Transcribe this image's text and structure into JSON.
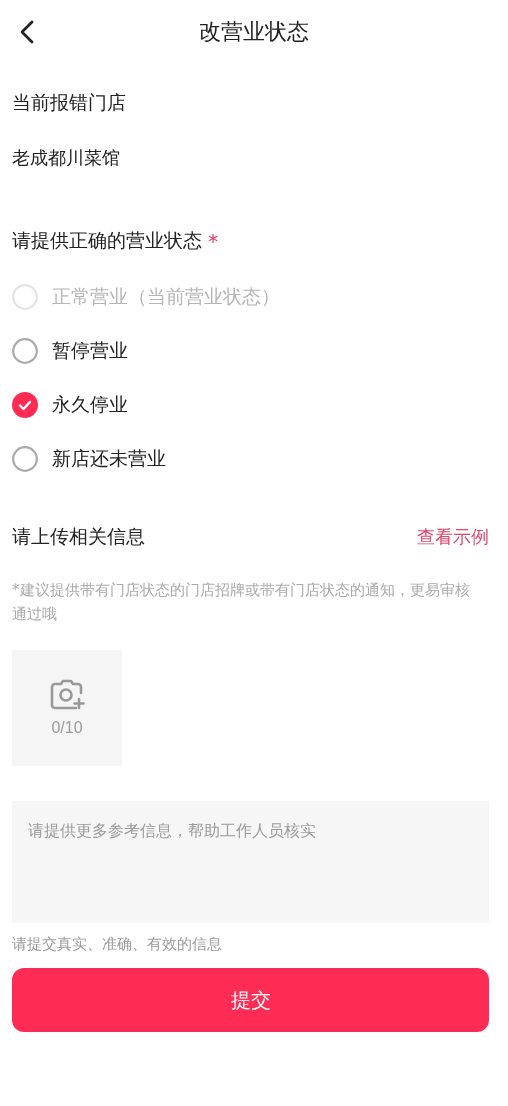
{
  "header": {
    "title": "改营业状态"
  },
  "store": {
    "label": "当前报错门店",
    "name": "老成都川菜馆"
  },
  "status": {
    "question": "请提供正确的营业状态",
    "required_mark": "*",
    "options": [
      {
        "label": "正常营业（当前营业状态）",
        "selected": false,
        "disabled": true
      },
      {
        "label": "暂停营业",
        "selected": false,
        "disabled": false
      },
      {
        "label": "永久停业",
        "selected": true,
        "disabled": false
      },
      {
        "label": "新店还未营业",
        "selected": false,
        "disabled": false
      }
    ]
  },
  "upload": {
    "title": "请上传相关信息",
    "example_link": "查看示例",
    "hint": "*建议提供带有门店状态的门店招牌或带有门店状态的通知，更易审核通过哦",
    "photo_count": "0/10"
  },
  "notes": {
    "placeholder": "请提供更多参考信息，帮助工作人员核实",
    "footnote": "请提交真实、准确、有效的信息"
  },
  "submit_button": "提交"
}
